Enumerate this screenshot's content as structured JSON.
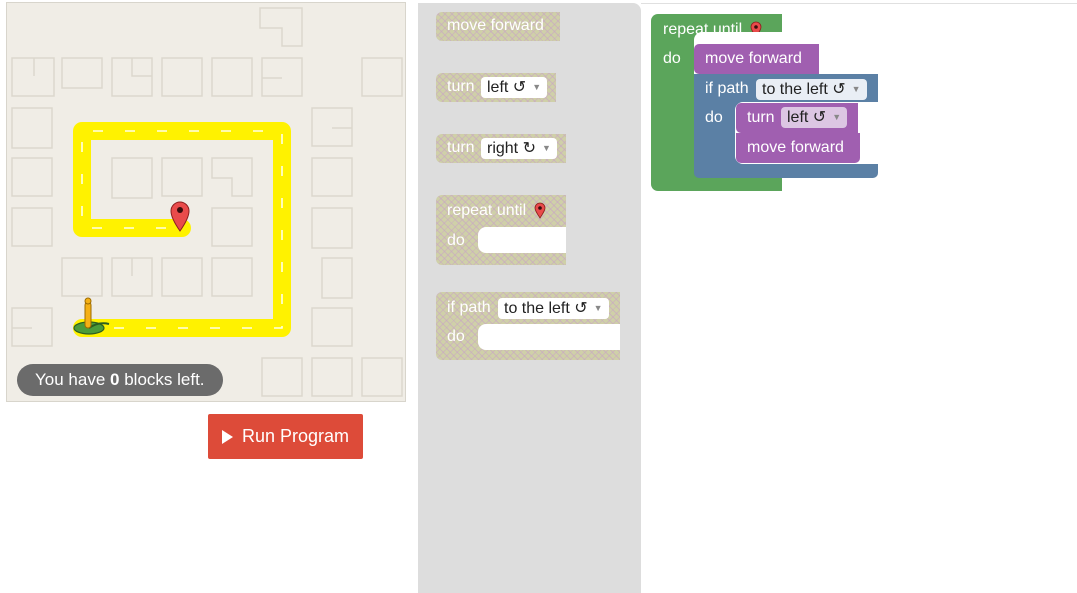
{
  "maze": {
    "blocks_left_prefix": "You have",
    "blocks_left_count": "0",
    "blocks_left_suffix": "blocks left."
  },
  "run_button": {
    "label": "Run Program",
    "color": "#dd4b39"
  },
  "toolbox": {
    "move_forward": "move forward",
    "turn_left": {
      "label": "turn",
      "value": "left ↺"
    },
    "turn_right": {
      "label": "turn",
      "value": "right ↻"
    },
    "repeat_until": {
      "label": "repeat until",
      "do": "do"
    },
    "if_path": {
      "label": "if path",
      "value": "to the left ↺",
      "do": "do"
    }
  },
  "workspace": {
    "repeat": {
      "label": "repeat until",
      "do": "do",
      "color": "#5ba55b"
    },
    "move1": {
      "label": "move forward",
      "color": "#a05fb0"
    },
    "if_path": {
      "label": "if path",
      "value": "to the left ↺",
      "do": "do",
      "color": "#5b80a5"
    },
    "turn": {
      "label": "turn",
      "value": "left ↺"
    },
    "move2": {
      "label": "move forward"
    }
  }
}
